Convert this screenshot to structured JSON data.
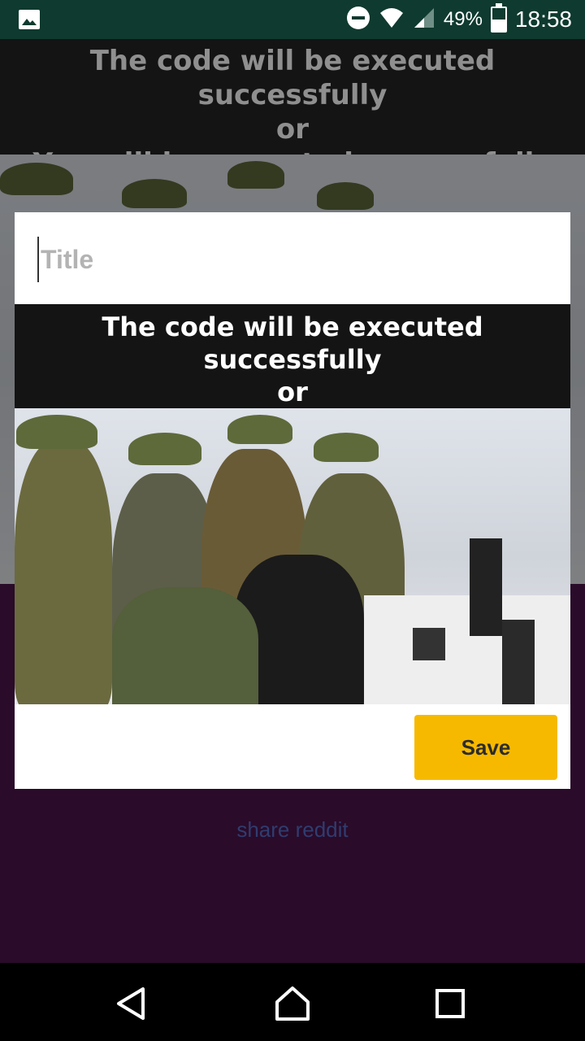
{
  "status_bar": {
    "battery_percent": "49%",
    "battery_level": 0.49,
    "time": "18:58",
    "icons": [
      "image-notification-icon",
      "do-not-disturb-icon",
      "wifi-icon",
      "cell-signal-icon",
      "battery-icon"
    ]
  },
  "meme": {
    "caption_line1": "The code will be executed successfully",
    "caption_line2": "or",
    "caption_line3": "You will be executed successfully"
  },
  "background": {
    "share_link": "share reddit"
  },
  "dialog": {
    "title_placeholder": "Title",
    "title_value": "",
    "save_label": "Save"
  },
  "colors": {
    "accent": "#f7b900",
    "background": "#2a0b2a",
    "status_bar": "#0f3a2f"
  },
  "nav_bar": {
    "icons": [
      "back-icon",
      "home-icon",
      "recents-icon"
    ]
  }
}
